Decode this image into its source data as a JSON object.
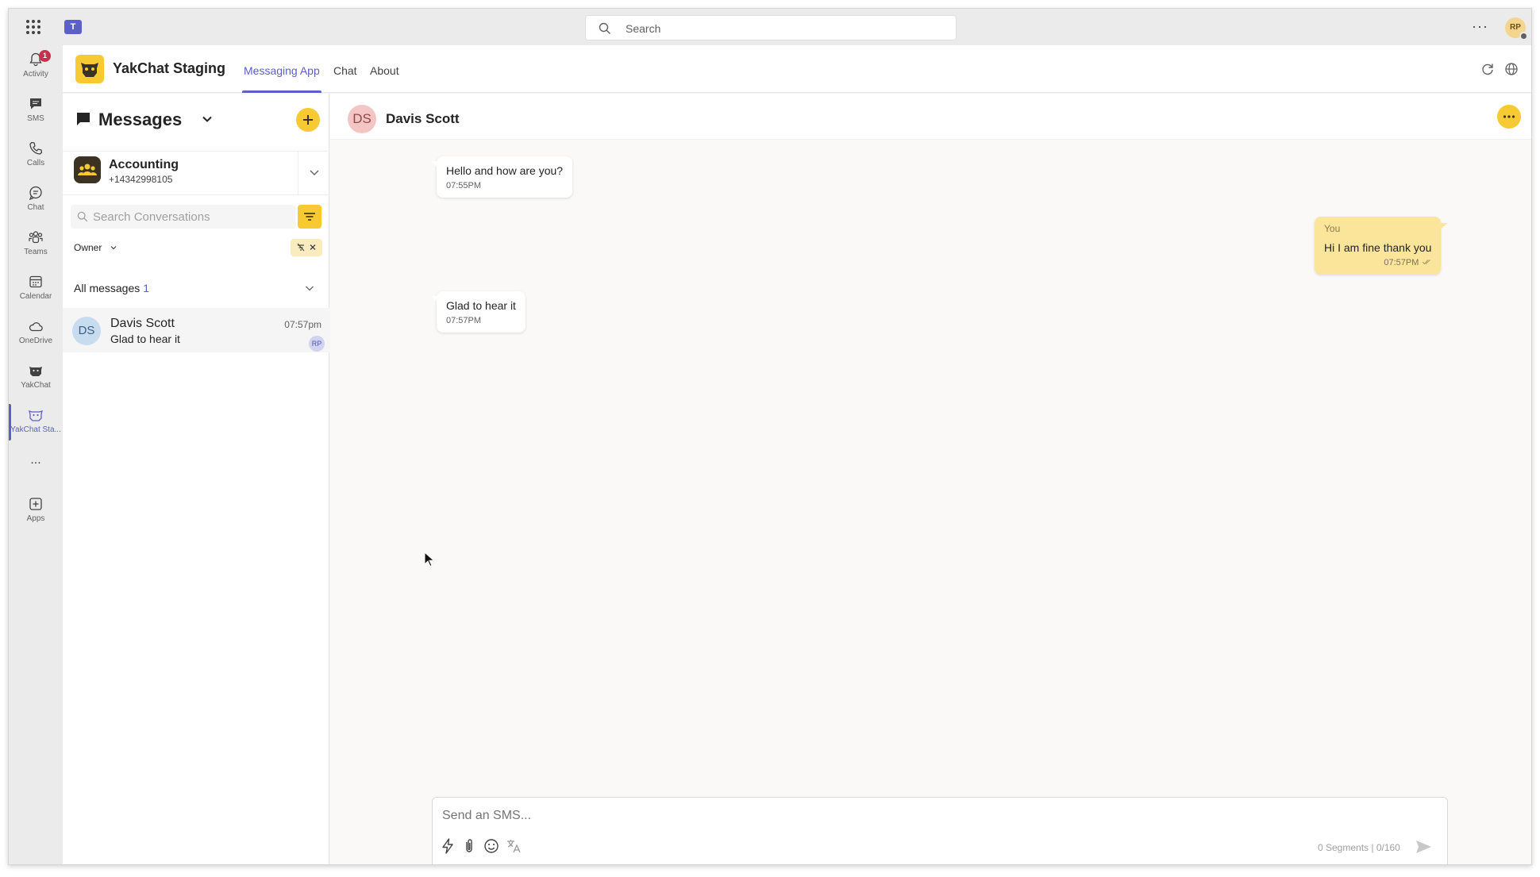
{
  "search": {
    "placeholder": "Search"
  },
  "user": {
    "initials": "RP"
  },
  "rail": {
    "items": [
      {
        "label": "Activity",
        "badge": "1"
      },
      {
        "label": "SMS"
      },
      {
        "label": "Calls"
      },
      {
        "label": "Chat"
      },
      {
        "label": "Teams"
      },
      {
        "label": "Calendar"
      },
      {
        "label": "OneDrive"
      },
      {
        "label": "YakChat"
      },
      {
        "label": "YakChat Sta..."
      },
      {
        "label": "..."
      },
      {
        "label": "Apps"
      }
    ]
  },
  "app": {
    "name": "YakChat Staging",
    "tabs": [
      "Messaging App",
      "Chat",
      "About"
    ],
    "active_tab": "Messaging App"
  },
  "messages_panel": {
    "title": "Messages",
    "account": {
      "name": "Accounting",
      "number": "+14342998105"
    },
    "search_placeholder": "Search Conversations",
    "owner_filter": "Owner",
    "section": {
      "label": "All messages",
      "count": "1"
    },
    "conversations": [
      {
        "initials": "DS",
        "name": "Davis Scott",
        "preview": "Glad to hear it",
        "time": "07:57pm",
        "owner": "RP"
      }
    ]
  },
  "chat": {
    "contact": {
      "initials": "DS",
      "name": "Davis Scott"
    },
    "messages": [
      {
        "direction": "in",
        "text": "Hello and how are you?",
        "time": "07:55PM"
      },
      {
        "direction": "out",
        "sender": "You",
        "text": "Hi I am fine thank you",
        "time": "07:57PM"
      },
      {
        "direction": "in",
        "text": "Glad to hear it",
        "time": "07:57PM"
      }
    ]
  },
  "composer": {
    "placeholder": "Send an SMS...",
    "segments": "0 Segments | 0/160"
  },
  "colors": {
    "accent": "#5b5fc7",
    "brand_yellow": "#f7c932",
    "outgoing_bubble": "#fbe59b",
    "badge_red": "#c4314b"
  },
  "icons": [
    "waffle-icon",
    "teams-logo-icon",
    "search-icon",
    "more-icon",
    "bell-icon",
    "sms-icon",
    "phone-icon",
    "chat-icon",
    "teams-icon",
    "calendar-icon",
    "cloud-icon",
    "yakchat-icon",
    "plus-square-icon",
    "refresh-icon",
    "globe-icon",
    "message-icon",
    "chevron-down-icon",
    "plus-icon",
    "group-icon",
    "filter-icon",
    "clear-filter-icon",
    "lightning-icon",
    "attach-icon",
    "emoji-icon",
    "translate-icon",
    "send-icon"
  ]
}
